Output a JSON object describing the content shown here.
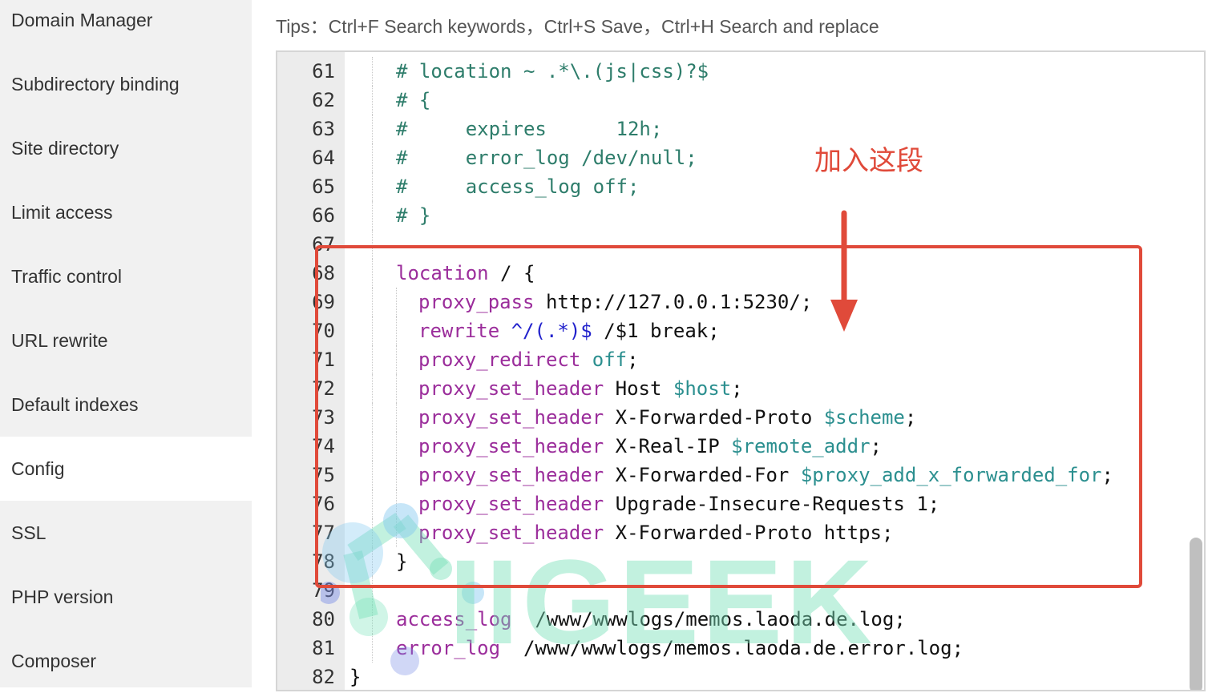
{
  "sidebar": {
    "items": [
      {
        "label": "Domain Manager"
      },
      {
        "label": "Subdirectory binding"
      },
      {
        "label": "Site directory"
      },
      {
        "label": "Limit access"
      },
      {
        "label": "Traffic control"
      },
      {
        "label": "URL rewrite"
      },
      {
        "label": "Default indexes"
      },
      {
        "label": "Config",
        "active": true
      },
      {
        "label": "SSL"
      },
      {
        "label": "PHP version"
      },
      {
        "label": "Composer"
      }
    ]
  },
  "tips": "Tips：Ctrl+F Search keywords，Ctrl+S Save，Ctrl+H Search and replace",
  "editor": {
    "lines": [
      {
        "n": "61",
        "indent": 1,
        "tokens": [
          {
            "t": "# location ~ .*\\.(js|css)?$",
            "c": "comment"
          }
        ]
      },
      {
        "n": "62",
        "indent": 1,
        "tokens": [
          {
            "t": "# {",
            "c": "comment"
          }
        ]
      },
      {
        "n": "63",
        "indent": 1,
        "tokens": [
          {
            "t": "#     expires      12h;",
            "c": "comment"
          }
        ]
      },
      {
        "n": "64",
        "indent": 1,
        "tokens": [
          {
            "t": "#     error_log /dev/null;",
            "c": "comment"
          }
        ]
      },
      {
        "n": "65",
        "indent": 1,
        "tokens": [
          {
            "t": "#     access_log off;",
            "c": "comment"
          }
        ]
      },
      {
        "n": "66",
        "indent": 1,
        "tokens": [
          {
            "t": "# }",
            "c": "comment"
          }
        ]
      },
      {
        "n": "67",
        "indent": 1,
        "tokens": []
      },
      {
        "n": "68",
        "indent": 1,
        "tokens": [
          {
            "t": "location",
            "c": "kw"
          },
          {
            "t": " / {",
            "c": "plain"
          }
        ]
      },
      {
        "n": "69",
        "indent": 2,
        "tokens": [
          {
            "t": "proxy_pass",
            "c": "kw"
          },
          {
            "t": " http://127.0.0.1:5230/;",
            "c": "plain"
          }
        ]
      },
      {
        "n": "70",
        "indent": 2,
        "tokens": [
          {
            "t": "rewrite",
            "c": "kw"
          },
          {
            "t": " ",
            "c": "plain"
          },
          {
            "t": "^/(.*)$",
            "c": "re"
          },
          {
            "t": " /$1 break;",
            "c": "plain"
          }
        ]
      },
      {
        "n": "71",
        "indent": 2,
        "tokens": [
          {
            "t": "proxy_redirect",
            "c": "kw"
          },
          {
            "t": " ",
            "c": "plain"
          },
          {
            "t": "off",
            "c": "var"
          },
          {
            "t": ";",
            "c": "plain"
          }
        ]
      },
      {
        "n": "72",
        "indent": 2,
        "tokens": [
          {
            "t": "proxy_set_header",
            "c": "kw"
          },
          {
            "t": " Host ",
            "c": "plain"
          },
          {
            "t": "$host",
            "c": "var"
          },
          {
            "t": ";",
            "c": "plain"
          }
        ]
      },
      {
        "n": "73",
        "indent": 2,
        "tokens": [
          {
            "t": "proxy_set_header",
            "c": "kw"
          },
          {
            "t": " X-Forwarded-Proto ",
            "c": "plain"
          },
          {
            "t": "$scheme",
            "c": "var"
          },
          {
            "t": ";",
            "c": "plain"
          }
        ]
      },
      {
        "n": "74",
        "indent": 2,
        "tokens": [
          {
            "t": "proxy_set_header",
            "c": "kw"
          },
          {
            "t": " X-Real-IP ",
            "c": "plain"
          },
          {
            "t": "$remote_addr",
            "c": "var"
          },
          {
            "t": ";",
            "c": "plain"
          }
        ]
      },
      {
        "n": "75",
        "indent": 2,
        "tokens": [
          {
            "t": "proxy_set_header",
            "c": "kw"
          },
          {
            "t": " X-Forwarded-For ",
            "c": "plain"
          },
          {
            "t": "$proxy_add_x_forwarded_for",
            "c": "var"
          },
          {
            "t": ";",
            "c": "plain"
          }
        ]
      },
      {
        "n": "76",
        "indent": 2,
        "tokens": [
          {
            "t": "proxy_set_header",
            "c": "kw"
          },
          {
            "t": " Upgrade-Insecure-Requests 1;",
            "c": "plain"
          }
        ]
      },
      {
        "n": "77",
        "indent": 2,
        "tokens": [
          {
            "t": "proxy_set_header",
            "c": "kw"
          },
          {
            "t": " X-Forwarded-Proto https;",
            "c": "plain"
          }
        ]
      },
      {
        "n": "78",
        "indent": 1,
        "tokens": [
          {
            "t": "}",
            "c": "plain"
          }
        ]
      },
      {
        "n": "79",
        "indent": 1,
        "tokens": []
      },
      {
        "n": "80",
        "indent": 1,
        "tokens": [
          {
            "t": "access_log",
            "c": "kw"
          },
          {
            "t": "  /www/wwwlogs/memos.laoda.de.log;",
            "c": "plain"
          }
        ]
      },
      {
        "n": "81",
        "indent": 1,
        "tokens": [
          {
            "t": "error_log",
            "c": "kw"
          },
          {
            "t": "  /www/wwwlogs/memos.laoda.de.error.log;",
            "c": "plain"
          }
        ]
      },
      {
        "n": "82",
        "indent": 0,
        "tokens": [
          {
            "t": "}",
            "c": "plain"
          }
        ]
      }
    ]
  },
  "annotation": {
    "text": "加入这段",
    "color": "#e04a3a"
  },
  "watermark": {
    "text": "IIGEEK"
  },
  "colors": {
    "comment": "#2e7d6b",
    "keyword": "#9b2d9b",
    "variable": "#2b8f8f",
    "regex": "#2222cc",
    "annotation": "#e04a3a"
  }
}
